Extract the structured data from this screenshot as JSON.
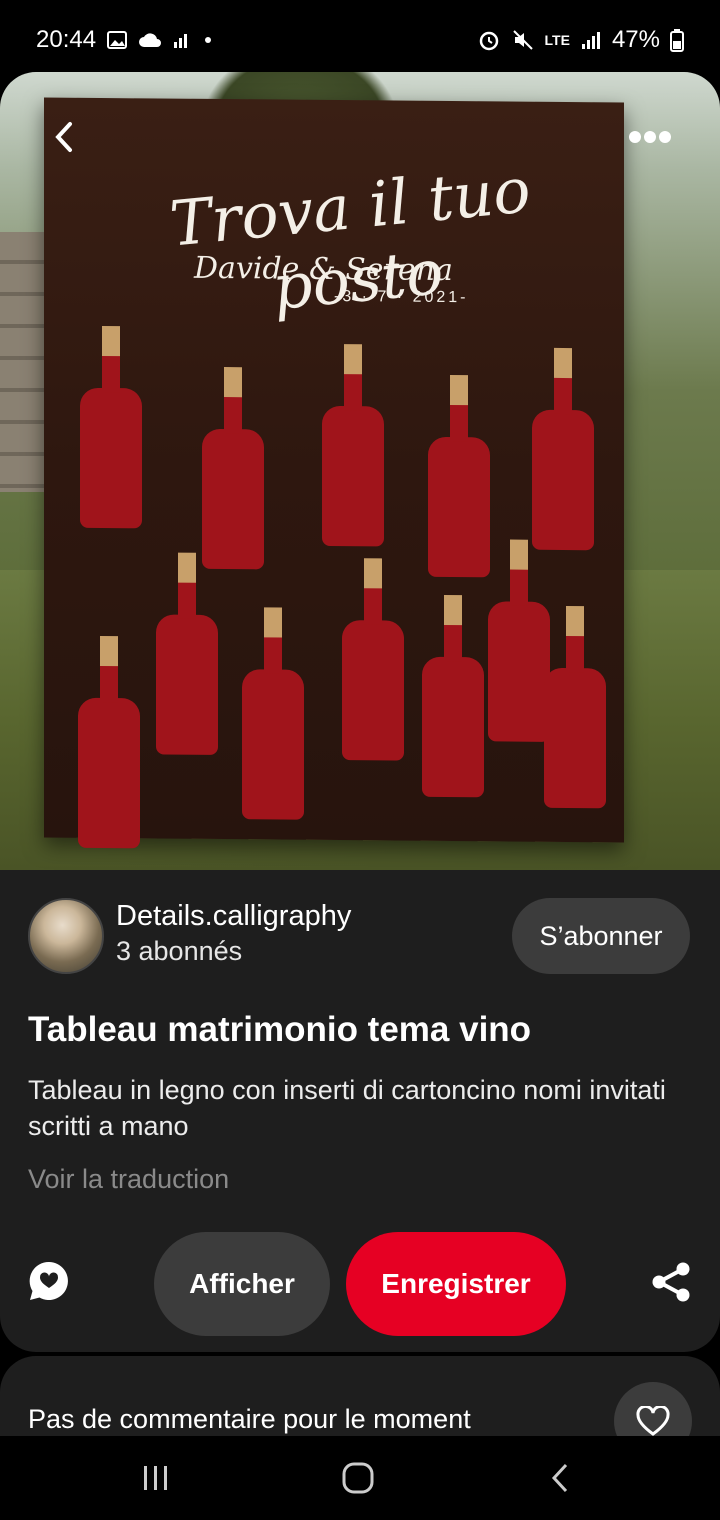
{
  "status_bar": {
    "time": "20:44",
    "network": "LTE",
    "battery": "47%"
  },
  "pin": {
    "creator": {
      "name": "Details.calligraphy",
      "followers": "3 abonnés",
      "follow_label": "S’abonner"
    },
    "title": "Tableau matrimonio tema vino",
    "description": "Tableau in legno con inserti di cartoncino nomi invitati scritti a mano",
    "translate_label": "Voir la traduction",
    "actions": {
      "view_label": "Afficher",
      "save_label": "Enregistrer"
    }
  },
  "comments": {
    "empty_label": "Pas de commentaire pour le moment"
  },
  "colors": {
    "save_button": "#e60023",
    "secondary_button": "#3c3c3c",
    "sheet_background": "#1e1e1e"
  },
  "icons": [
    "back-arrow-icon",
    "more-options-icon",
    "comment-icon",
    "share-icon",
    "heart-icon",
    "recents-icon",
    "home-icon",
    "back-icon"
  ]
}
